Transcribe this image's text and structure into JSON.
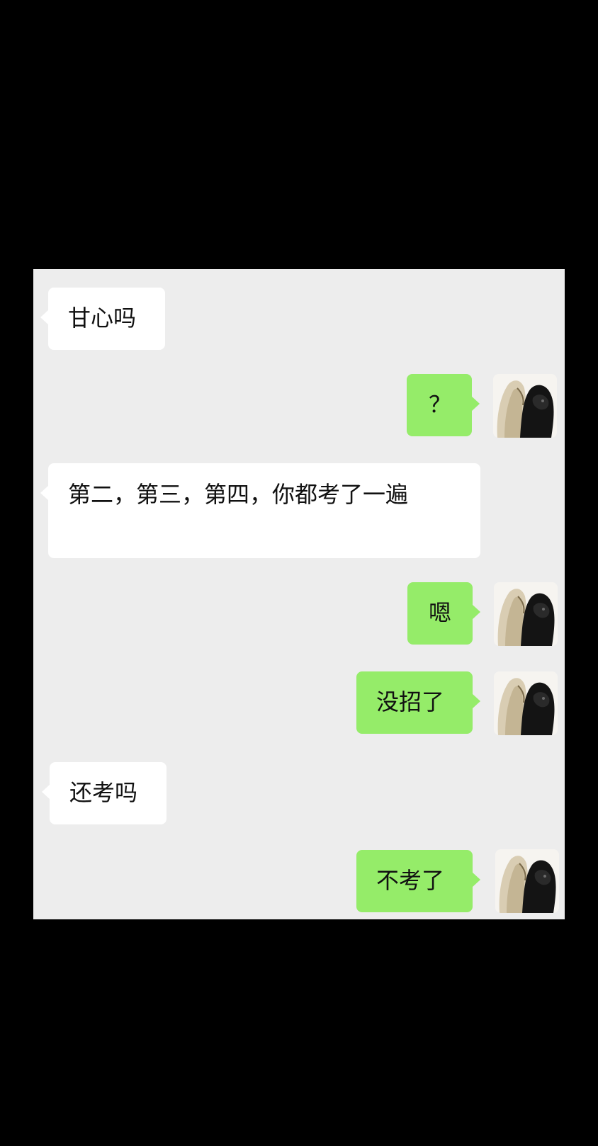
{
  "conversation": {
    "messages": [
      {
        "side": "in",
        "text": "甘心吗"
      },
      {
        "side": "out",
        "text": "？"
      },
      {
        "side": "in",
        "text": "第二，第三，第四，你都考了一遍"
      },
      {
        "side": "out",
        "text": "嗯"
      },
      {
        "side": "out",
        "text": "没招了"
      },
      {
        "side": "in",
        "text": "还考吗"
      },
      {
        "side": "out",
        "text": "不考了"
      }
    ]
  },
  "colors": {
    "background": "#000000",
    "chat_background": "#ededed",
    "incoming_bubble": "#ffffff",
    "outgoing_bubble": "#95ec69",
    "text": "#111111"
  },
  "icons": {
    "self_avatar": "avatar-blonde-and-black-hair-image"
  }
}
